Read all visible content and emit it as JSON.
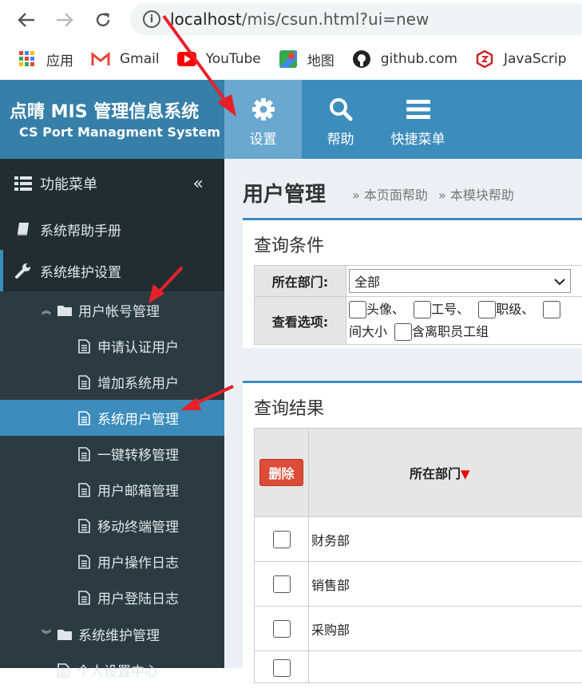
{
  "browser": {
    "url_host": "localhost",
    "url_path": "/mis/csun.html?ui=new",
    "bookmarks": [
      {
        "label": "应用",
        "icon": "apps-grid-icon"
      },
      {
        "label": "Gmail",
        "icon": "gmail-icon"
      },
      {
        "label": "YouTube",
        "icon": "youtube-icon"
      },
      {
        "label": "地图",
        "icon": "maps-icon"
      },
      {
        "label": "github.com",
        "icon": "github-icon"
      },
      {
        "label": "JavaScrip",
        "icon": "javascript-icon"
      }
    ]
  },
  "header": {
    "logo_title": "点晴 MIS 管理信息系统",
    "logo_subtitle": "CS Port Managment System",
    "buttons": [
      {
        "label": "设置",
        "icon": "gear-icon"
      },
      {
        "label": "帮助",
        "icon": "search-icon"
      },
      {
        "label": "快捷菜单",
        "icon": "menu-icon"
      }
    ]
  },
  "sidebar": {
    "title": "功能菜单",
    "items": [
      {
        "label": "系统帮助手册"
      },
      {
        "label": "系统维护设置"
      },
      {
        "label": "用户帐号管理"
      },
      {
        "label": "申请认证用户"
      },
      {
        "label": "增加系统用户"
      },
      {
        "label": "系统用户管理"
      },
      {
        "label": "一键转移管理"
      },
      {
        "label": "用户邮箱管理"
      },
      {
        "label": "移动终端管理"
      },
      {
        "label": "用户操作日志"
      },
      {
        "label": "用户登陆日志"
      },
      {
        "label": "系统维护管理"
      },
      {
        "label": "个人设置中心"
      }
    ]
  },
  "main": {
    "title": "用户管理",
    "crumbs": [
      "» 本页面帮助",
      "» 本模块帮助"
    ],
    "query": {
      "title": "查询条件",
      "dept_label": "所在部门:",
      "dept_value": "全部",
      "view_label": "查看选项:",
      "options": [
        "头像、",
        "工号、",
        "职级、"
      ],
      "line2_text": "间大小",
      "option_leave": "含离职员工组"
    },
    "results": {
      "title": "查询结果",
      "delete_label": "删除",
      "col_dept": "所在部门",
      "sort_marker": "▼",
      "rows": [
        "财务部",
        "销售部",
        "采购部"
      ]
    }
  }
}
